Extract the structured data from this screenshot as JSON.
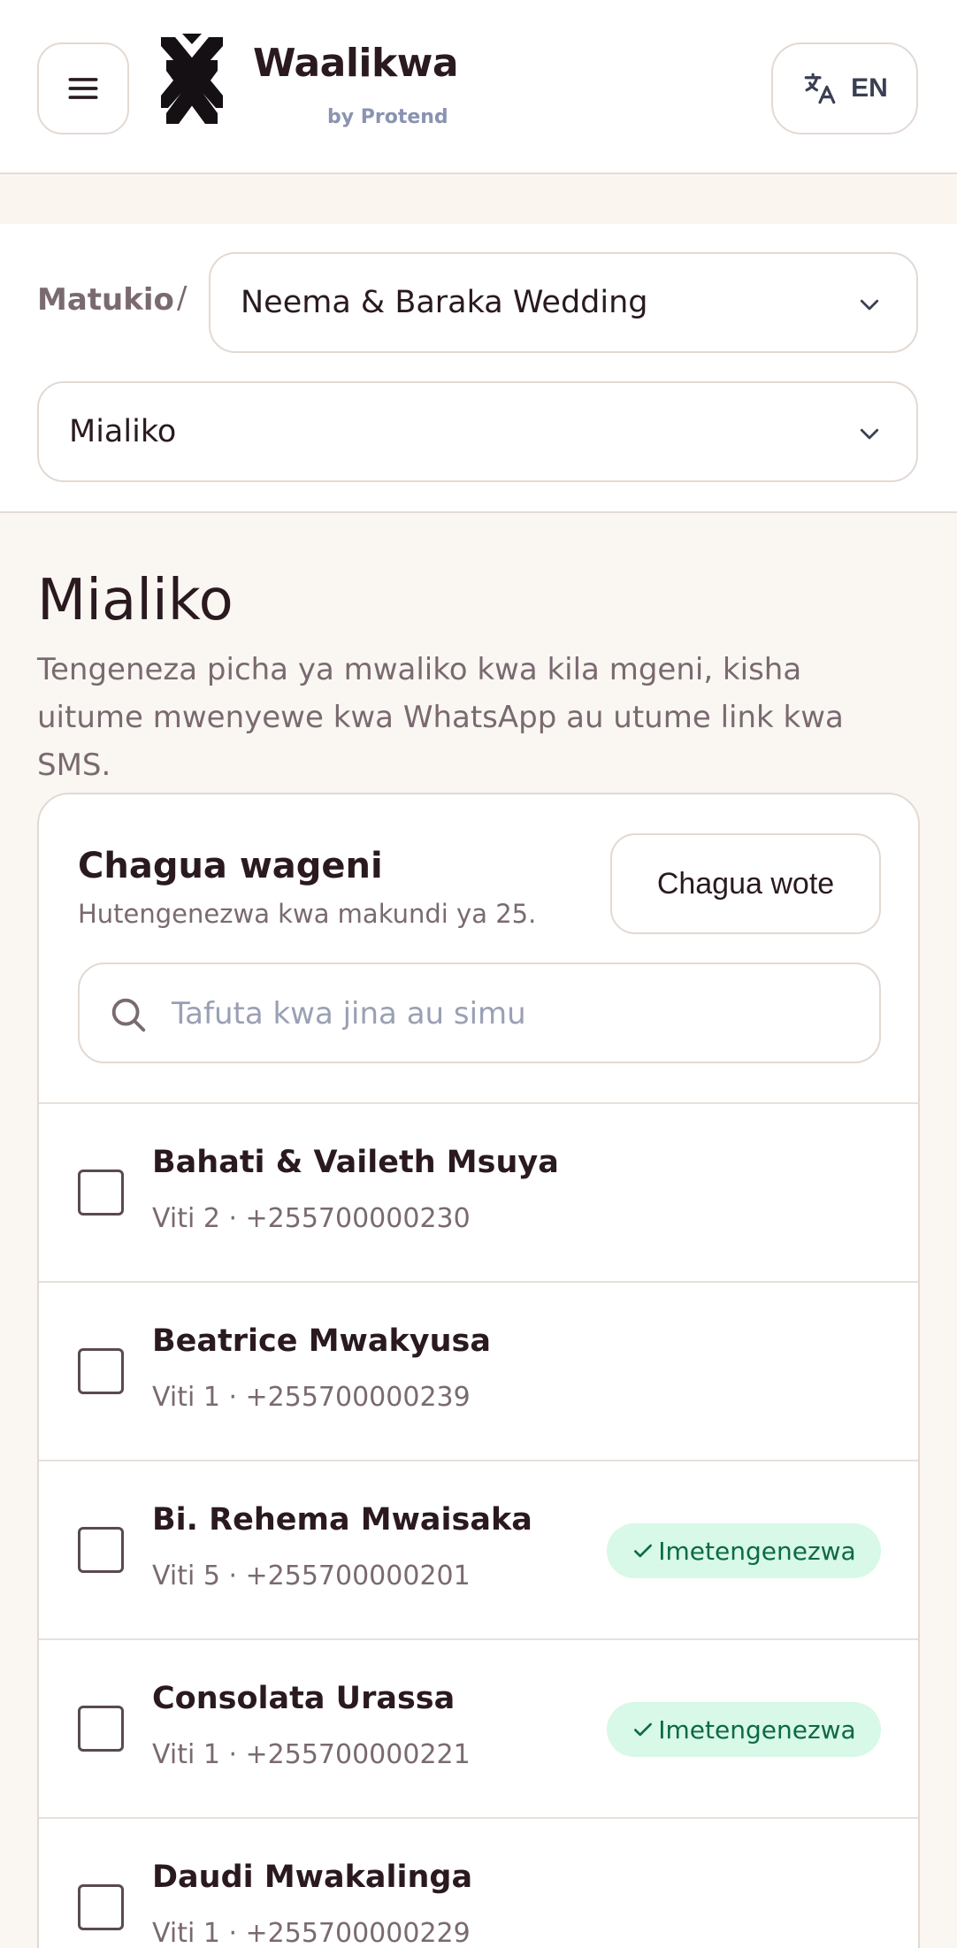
{
  "header": {
    "brand_name": "Waalikwa",
    "brand_by": "by Protend",
    "language_label": "EN",
    "icons": {
      "menu": "hamburger-menu-icon",
      "logo": "waalikwa-logo-icon",
      "language": "translate-icon"
    }
  },
  "context": {
    "breadcrumb_root": "Matukio",
    "breadcrumb_separator": "/",
    "event_select_value": "Neema & Baraka Wedding",
    "page_select_value": "Mialiko"
  },
  "main": {
    "title": "Mialiko",
    "description": "Tengeneza picha ya mwaliko kwa kila mgeni, kisha uitume mwenyewe kwa WhatsApp au utume link kwa SMS."
  },
  "guest_card": {
    "title": "Chagua wageni",
    "subtitle": "Hutengenezwa kwa makundi ya 25.",
    "select_all_label": "Chagua wote",
    "search_placeholder": "Tafuta kwa jina au simu",
    "guests": [
      {
        "name": "Bahati & Vaileth Msuya",
        "meta": "Viti 2 · +255700000230",
        "badge": ""
      },
      {
        "name": "Beatrice Mwakyusa",
        "meta": "Viti 1 · +255700000239",
        "badge": ""
      },
      {
        "name": "Bi. Rehema Mwaisaka",
        "meta": "Viti 5 · +255700000201",
        "badge": "Imetengenezwa"
      },
      {
        "name": "Consolata Urassa",
        "meta": "Viti 1 · +255700000221",
        "badge": "Imetengenezwa"
      },
      {
        "name": "Daudi Mwakalinga",
        "meta": "Viti 1 · +255700000229",
        "badge": ""
      }
    ]
  },
  "colors": {
    "background": "#faf7f3",
    "text": "#2a1a1f",
    "muted": "#7a6a70",
    "border": "#e3d9d2",
    "badge_bg": "#d8f8e8",
    "badge_text": "#0c6a45"
  }
}
